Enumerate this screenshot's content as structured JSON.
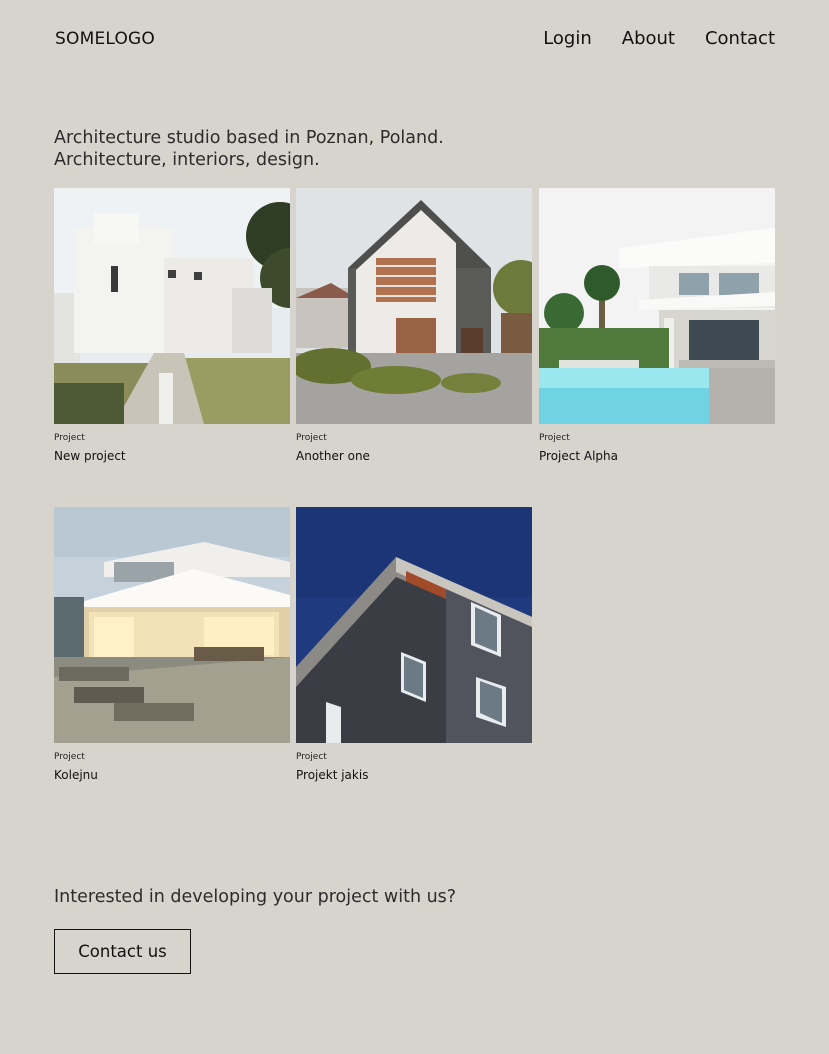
{
  "header": {
    "logo": "SOMELOGO",
    "nav": [
      {
        "label": "Login"
      },
      {
        "label": "About"
      },
      {
        "label": "Contact"
      }
    ]
  },
  "intro": {
    "line1": "Architecture studio based in Poznan, Poland.",
    "line2": "Architecture, interiors, design."
  },
  "projects": [
    {
      "category": "Project",
      "title": "New project"
    },
    {
      "category": "Project",
      "title": "Another one"
    },
    {
      "category": "Project",
      "title": "Project Alpha"
    },
    {
      "category": "Project",
      "title": "Kolejnu"
    },
    {
      "category": "Project",
      "title": "Projekt jakis"
    }
  ],
  "cta": {
    "text": "Interested in developing your project with us?",
    "button_label": "Contact us"
  },
  "colors": {
    "background": "#d6d4cc",
    "text": "#111111"
  }
}
